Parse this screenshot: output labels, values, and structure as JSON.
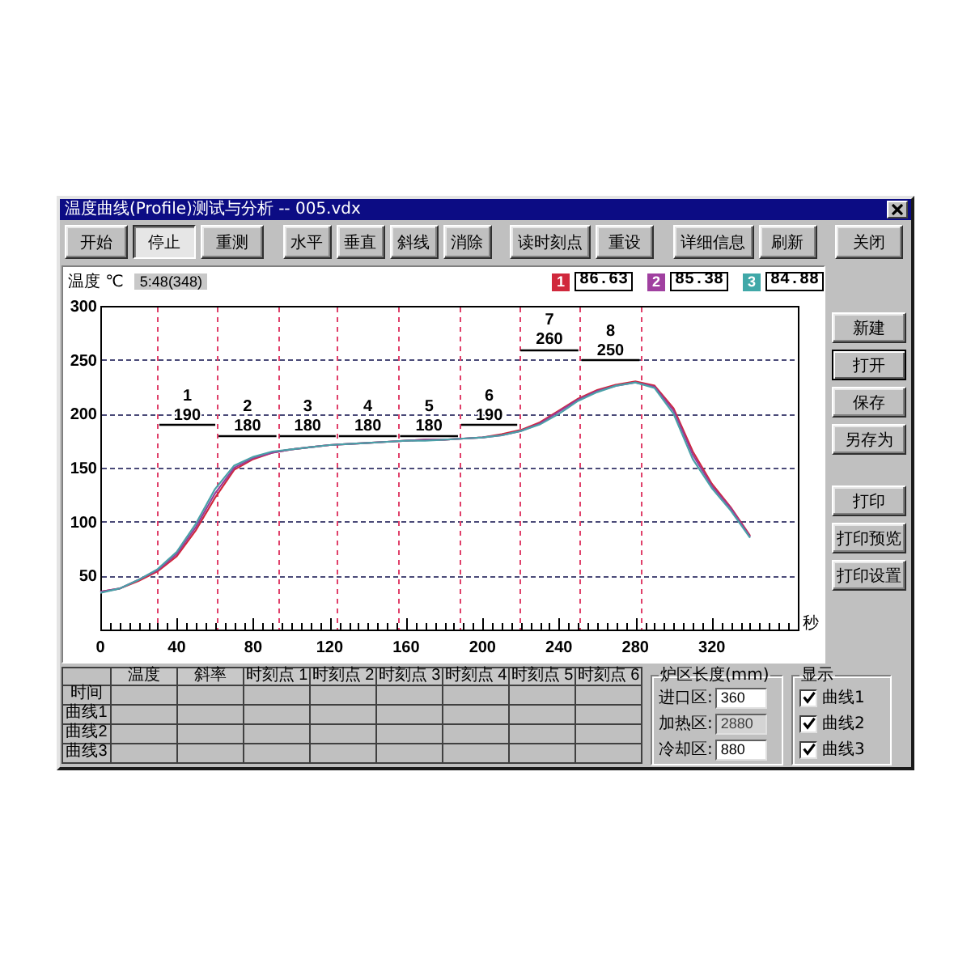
{
  "window": {
    "title": "温度曲线(Profile)测试与分析 -- 005.vdx"
  },
  "toolbar": {
    "groups": [
      {
        "buttons": [
          {
            "label": "开始",
            "selected": false
          },
          {
            "label": "停止",
            "selected": true
          },
          {
            "label": "重测",
            "selected": false
          }
        ]
      },
      {
        "buttons": [
          {
            "label": "水平",
            "selected": false
          },
          {
            "label": "垂直",
            "selected": false
          },
          {
            "label": "斜线",
            "selected": false
          },
          {
            "label": "消除",
            "selected": false
          }
        ]
      },
      {
        "buttons": [
          {
            "label": "读时刻点",
            "selected": false
          },
          {
            "label": "重设",
            "selected": false
          }
        ]
      },
      {
        "buttons": [
          {
            "label": "详细信息",
            "selected": false
          },
          {
            "label": "刷新",
            "selected": false
          }
        ]
      },
      {
        "buttons": [
          {
            "label": "关闭",
            "selected": false
          }
        ]
      }
    ]
  },
  "chart_panel": {
    "cursor_time": "5:48(348)",
    "readings": [
      {
        "label": "1",
        "value": "86.63",
        "color": "#d0283c"
      },
      {
        "label": "2",
        "value": "85.38",
        "color": "#a040a0"
      },
      {
        "label": "3",
        "value": "84.88",
        "color": "#40a8a8"
      }
    ],
    "chart_data": {
      "type": "line",
      "ylabel": "温度 ℃",
      "xlabel": "秒",
      "x": [
        0,
        10,
        20,
        30,
        40,
        50,
        60,
        70,
        80,
        90,
        100,
        110,
        120,
        130,
        140,
        150,
        160,
        170,
        180,
        190,
        200,
        210,
        220,
        230,
        240,
        250,
        260,
        270,
        280,
        290,
        300,
        310,
        320,
        330,
        340
      ],
      "series": [
        {
          "color": "#d0283c",
          "values": [
            35,
            38,
            45,
            54,
            68,
            92,
            122,
            148,
            158,
            164,
            167,
            169,
            171,
            172,
            173,
            174,
            175,
            176,
            176,
            177,
            178,
            181,
            185,
            192,
            203,
            214,
            222,
            227,
            230,
            226,
            205,
            165,
            135,
            113,
            87
          ]
        },
        {
          "color": "#983c98",
          "values": [
            35,
            38,
            46,
            55,
            70,
            95,
            126,
            150,
            159,
            164,
            167,
            169,
            171,
            172,
            173,
            174,
            175,
            176,
            176,
            177,
            178,
            180,
            184,
            191,
            202,
            213,
            221,
            226,
            229,
            225,
            203,
            162,
            133,
            112,
            86
          ]
        },
        {
          "color": "#4aa0a8",
          "values": [
            34,
            38,
            46,
            56,
            72,
            98,
            130,
            152,
            160,
            165,
            167,
            169,
            171,
            172,
            173,
            174,
            175,
            175,
            176,
            177,
            178,
            180,
            184,
            190,
            200,
            212,
            220,
            226,
            229,
            224,
            200,
            158,
            131,
            110,
            85
          ]
        }
      ],
      "xlim": [
        0,
        365
      ],
      "ylim": [
        0,
        300
      ],
      "xticks": [
        0,
        40,
        80,
        120,
        160,
        200,
        240,
        280,
        320
      ],
      "yticks": [
        50,
        100,
        150,
        200,
        250,
        300
      ],
      "grid": true,
      "ref_lines": [
        {
          "axis": "x",
          "value": 30
        },
        {
          "axis": "x",
          "value": 61
        },
        {
          "axis": "x",
          "value": 93
        },
        {
          "axis": "x",
          "value": 124
        },
        {
          "axis": "x",
          "value": 156
        },
        {
          "axis": "x",
          "value": 188
        },
        {
          "axis": "x",
          "value": 219
        },
        {
          "axis": "x",
          "value": 251
        },
        {
          "axis": "x",
          "value": 283
        }
      ],
      "annotations": [
        "1",
        "190",
        "2",
        "180",
        "3",
        "180",
        "4",
        "180",
        "5",
        "180",
        "6",
        "190",
        "7",
        "260",
        "8",
        "250"
      ]
    }
  },
  "side_panel": {
    "groups": [
      {
        "buttons": [
          {
            "label": "新建",
            "focused": false
          },
          {
            "label": "打开",
            "focused": true
          },
          {
            "label": "保存",
            "focused": false
          },
          {
            "label": "另存为",
            "focused": false
          }
        ]
      },
      {
        "buttons": [
          {
            "label": "打印",
            "focused": false
          },
          {
            "label": "打印预览",
            "focused": false
          },
          {
            "label": "打印设置",
            "focused": false
          }
        ]
      }
    ]
  },
  "table": {
    "columns": [
      "温度",
      "斜率",
      "时刻点 1",
      "时刻点 2",
      "时刻点 3",
      "时刻点 4",
      "时刻点 5",
      "时刻点 6"
    ],
    "rows": [
      {
        "label": "时间"
      },
      {
        "label": "曲线1"
      },
      {
        "label": "曲线2"
      },
      {
        "label": "曲线3"
      }
    ]
  },
  "zone_lengths": {
    "title": "炉区长度(mm)",
    "fields": [
      {
        "label": "进口区:",
        "value": "360",
        "disabled": false
      },
      {
        "label": "加热区:",
        "value": "2880",
        "disabled": true
      },
      {
        "label": "冷却区:",
        "value": "880",
        "disabled": false
      }
    ]
  },
  "display": {
    "title": "显示",
    "items": [
      {
        "label": "曲线1",
        "checked": true
      },
      {
        "label": "曲线2",
        "checked": true
      },
      {
        "label": "曲线3",
        "checked": true
      }
    ]
  }
}
